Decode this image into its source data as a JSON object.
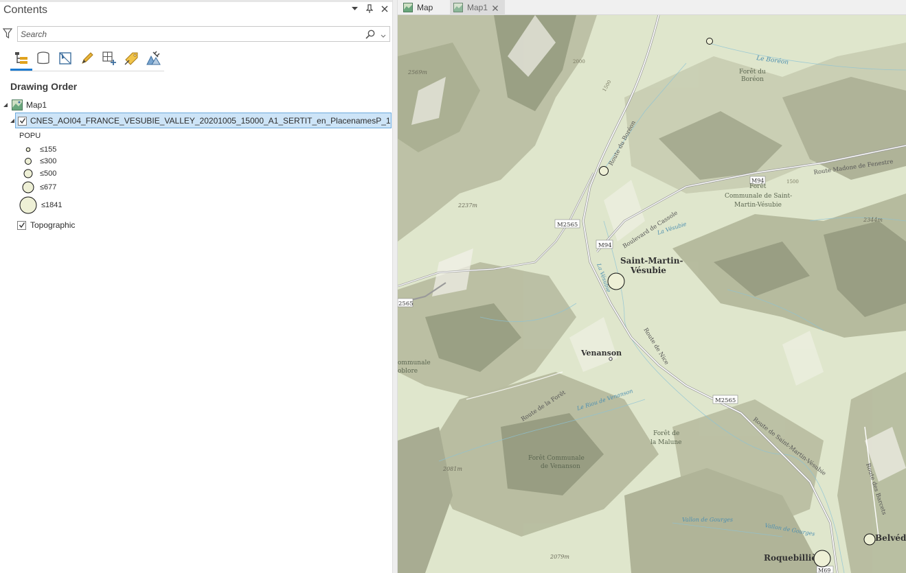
{
  "contents": {
    "title": "Contents",
    "search": {
      "placeholder": "Search"
    },
    "section_heading": "Drawing Order",
    "tools": [
      "list-by-drawing-order-icon",
      "list-by-source-icon",
      "list-by-selection-icon",
      "list-by-editing-icon",
      "list-by-snapping-icon",
      "list-by-labeling-icon",
      "list-by-perspective-imagery-icon"
    ],
    "map_name": "Map1",
    "layer": {
      "name": "CNES_AOI04_FRANCE_VESUBIE_VALLEY_20201005_15000_A1_SERTIT_en_PlacenamesP_1",
      "checked": true,
      "legend_field": "POPU",
      "classes": [
        {
          "label": "≤155"
        },
        {
          "label": "≤300"
        },
        {
          "label": "≤500"
        },
        {
          "label": "≤677"
        },
        {
          "label": "≤1841"
        }
      ]
    },
    "basemap": {
      "name": "Topographic",
      "checked": true
    }
  },
  "tabs": [
    {
      "label": "Map",
      "active": true
    },
    {
      "label": "Map1",
      "active": false
    }
  ],
  "map": {
    "symbol_fill": "#eef0d6",
    "labels": {
      "boreon": "Le Boréon",
      "foret_boreon_1": "Forêt du",
      "foret_boreon_2": "Boréon",
      "route_boreon": "Route du Boréon",
      "route_fenestre": "Route Madone de Fenestre",
      "route_cassole": "Boulevard de Cassole",
      "foret_stmartin_1": "Forêt",
      "foret_stmartin_2": "Communale de Saint-",
      "foret_stmartin_3": "Martin-Vésubie",
      "la_vesubie": "La Vésubie",
      "m94_a": "M94",
      "m94_b": "M94",
      "m2565_a": "M2565",
      "m2565_b": "M2565",
      "m2565_c": "2565",
      "m69": "M69",
      "elev_2569": "2569m",
      "elev_2237": "2237m",
      "elev_2344": "2344m",
      "elev_2081": "2081m",
      "elev_2079": "2079m",
      "elev_1500": "1500",
      "elev_2000": "2000",
      "stmartin_1": "Saint-Martin-",
      "stmartin_2": "Vésubie",
      "venanson": "Venanson",
      "communale_1": "ommunale",
      "communale_2": "oblore",
      "route_foret": "Route de la Forêt",
      "route_nice": "Route de Nice",
      "riou": "Le Riou de Venanson",
      "route_stmartin": "Route de Saint-Martin-Vésubie",
      "foret_malune_1": "Forêt de",
      "foret_malune_2": "la Malune",
      "foret_venanson_1": "Forêt Communale",
      "foret_venanson_2": "de Venanson",
      "vallon_1": "Vallon de Gourges",
      "vallon_2": "Vallon de Gourges",
      "route_barcets": "Route des Barcets",
      "roquebilliere": "Roquebillière",
      "belvedere": "Belvédère"
    }
  }
}
